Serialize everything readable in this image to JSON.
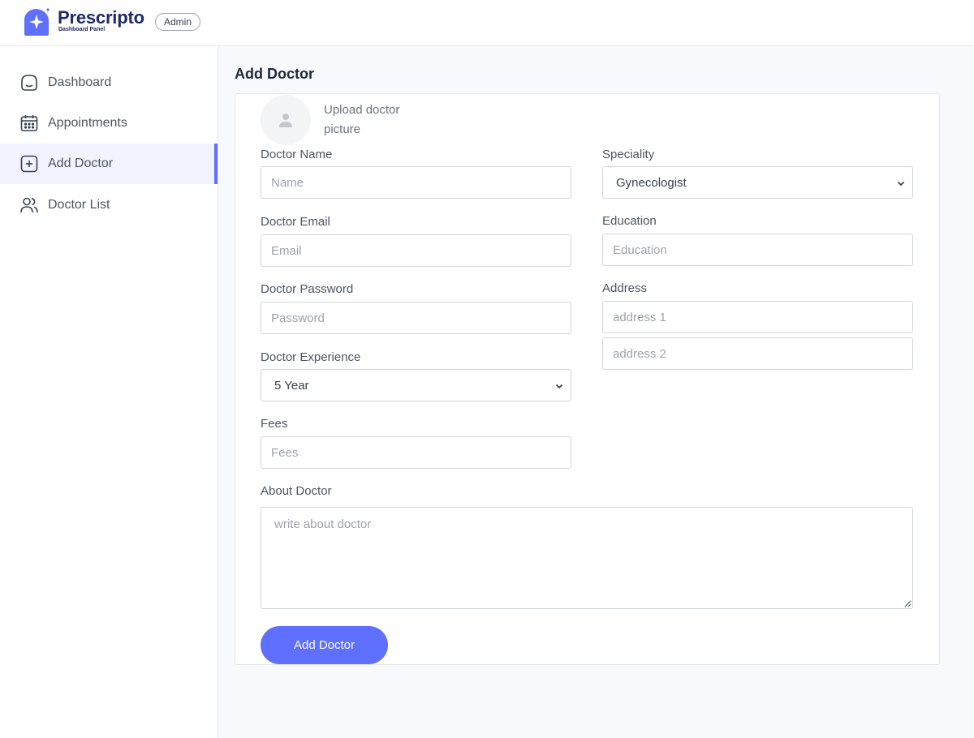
{
  "header": {
    "app_name": "Prescripto",
    "app_subtitle": "Dashboard Panel",
    "role": "Admin",
    "logo_icon": "sparkle-house-icon"
  },
  "sidebar": {
    "items": [
      {
        "label": "Dashboard",
        "icon": "home-icon",
        "active": false
      },
      {
        "label": "Appointments",
        "icon": "calendar-icon",
        "active": false
      },
      {
        "label": "Add Doctor",
        "icon": "add-square-icon",
        "active": true
      },
      {
        "label": "Doctor List",
        "icon": "people-icon",
        "active": false
      }
    ]
  },
  "page": {
    "title": "Add Doctor"
  },
  "form": {
    "upload_label": "Upload doctor picture",
    "name": {
      "label": "Doctor Name",
      "placeholder": "Name",
      "value": ""
    },
    "email": {
      "label": "Doctor Email",
      "placeholder": "Email",
      "value": ""
    },
    "password": {
      "label": "Doctor Password",
      "placeholder": "Password",
      "value": ""
    },
    "experience": {
      "label": "Doctor Experience",
      "selected": "5 Year"
    },
    "fees": {
      "label": "Fees",
      "placeholder": "Fees",
      "value": ""
    },
    "speciality": {
      "label": "Speciality",
      "selected": "Gynecologist"
    },
    "education": {
      "label": "Education",
      "placeholder": "Education",
      "value": ""
    },
    "address": {
      "label": "Address",
      "line1_placeholder": "address 1",
      "line2_placeholder": "address 2"
    },
    "about": {
      "label": "About Doctor",
      "placeholder": "write about doctor"
    },
    "submit_label": "Add Doctor"
  },
  "colors": {
    "accent": "#5f6fff",
    "active_bg": "#f2f3ff",
    "brand_text": "#1f2a6b"
  }
}
